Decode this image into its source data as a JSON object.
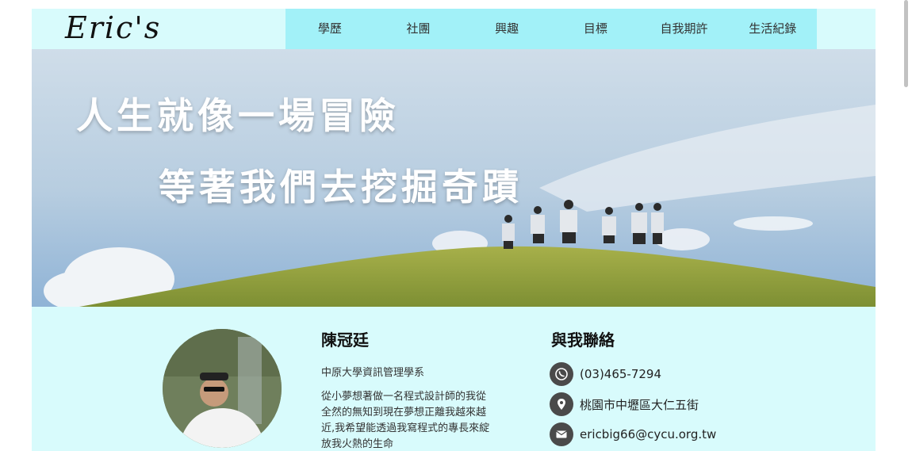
{
  "site": {
    "logo": "Eric's"
  },
  "nav": {
    "items": [
      "學歷",
      "社團",
      "興趣",
      "目標",
      "自我期許",
      "生活紀錄"
    ]
  },
  "hero": {
    "line1": "人生就像一場冒險",
    "line2": "等著我們去挖掘奇蹟"
  },
  "profile": {
    "name": "陳冠廷",
    "department": "中原大學資訊管理學系",
    "bio": "從小夢想著做一名程式設計師的我從全然的無知到現在夢想正離我越來越近,我希望能透過我寫程式的專長來綻放我火熱的生命"
  },
  "contact": {
    "title": "與我聯絡",
    "phone": "(03)465-7294",
    "address": "桃園市中壢區大仁五街",
    "email": "ericbig66@cycu.org.tw"
  },
  "colors": {
    "header_bg": "#d8fbfc",
    "nav_bg": "#a2f1f8",
    "content_bg": "#d8fbfc",
    "icon_bg": "#4a4a4a"
  },
  "icons": {
    "phone": "whatsapp-icon",
    "address": "location-pin-icon",
    "email": "mail-icon"
  }
}
